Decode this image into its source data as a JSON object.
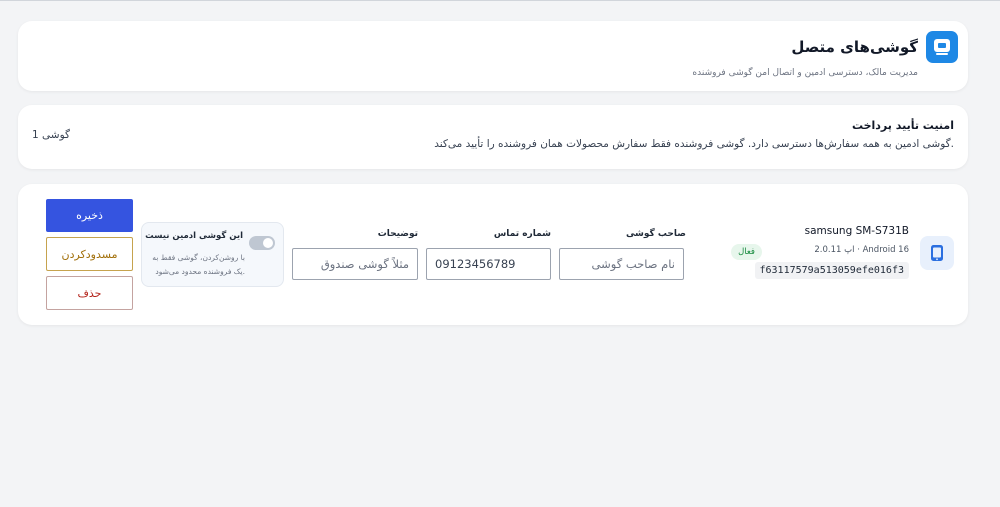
{
  "header": {
    "title": "گوشی‌های متصل",
    "subtitle": "مدیریت مالک، دسترسی ادمین و اتصال امن گوشی فروشنده",
    "logo_icon": "app-logo-icon",
    "logo_color": "#1e88e5"
  },
  "notice": {
    "title": "امنیت تأیید پرداخت",
    "body": "گوشی ادمین به همه سفارش‌ها دسترسی دارد. گوشی فروشنده فقط سفارش محصولات همان فروشنده را تأیید می‌کند.",
    "count": "1 گوشی"
  },
  "device": {
    "icon": "phone-icon",
    "model": "samsung SM-S731B",
    "meta": "Android 16 · اپ 2.0.11",
    "id": "f63117579a513059efe016f3",
    "status": "فعال",
    "status_color": "#178a3e",
    "owner_label": "صاحب گوشی",
    "owner_placeholder": "نام صاحب گوشی",
    "owner_value": "",
    "phone_label": "شماره تماس",
    "phone_value": "09123456789",
    "notes_label": "توضیحات",
    "notes_placeholder": "مثلاً گوشی صندوق",
    "notes_value": "",
    "admin_toggle_title": "این گوشی ادمین نیست",
    "admin_toggle_on": false,
    "admin_toggle_help": "با روشن‌کردن، گوشی فقط به یک فروشنده محدود می‌شود.",
    "save_label": "ذخیره",
    "block_label": "مسدودکردن",
    "delete_label": "حذف",
    "accent_color": "#3554e0"
  }
}
